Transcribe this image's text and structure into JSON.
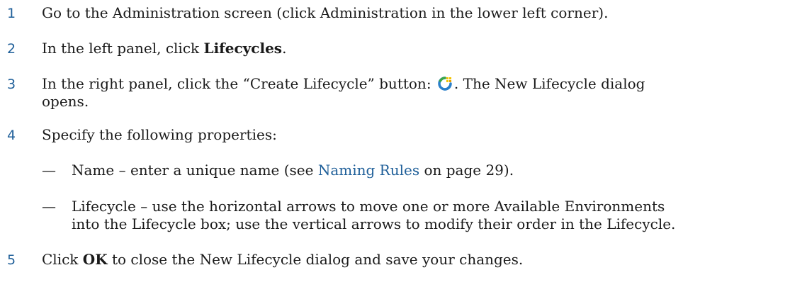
{
  "steps": [
    {
      "num": "1",
      "text": "Go to the Administration screen (click Administration in the lower left corner)."
    },
    {
      "num": "2",
      "pre": "In the left panel, click ",
      "bold": "Lifecycles",
      "post": "."
    },
    {
      "num": "3",
      "pre": "In the right panel, click the “Create Lifecycle” button: ",
      "post": ". The New Lifecycle dialog",
      "line2": "opens.",
      "icon": "create-lifecycle-icon"
    },
    {
      "num": "4",
      "text": "Specify the following properties:"
    },
    {
      "num": "5",
      "pre": "Click ",
      "bold": "OK",
      "post": " to close the New Lifecycle dialog and save your changes."
    }
  ],
  "properties": [
    {
      "dash": "—",
      "pre": "Name – enter a unique name (see ",
      "link": "Naming Rules",
      "post": " on page 29)."
    },
    {
      "dash": "—",
      "line1": "Lifecycle – use the horizontal arrows to move one or more Available Environments",
      "line2": "into the Lifecycle box; use the vertical arrows to modify their order in the Lifecycle."
    }
  ],
  "colors": {
    "step_number": "#1f5f99",
    "link": "#1f5f99",
    "text": "#1a1a1a"
  }
}
